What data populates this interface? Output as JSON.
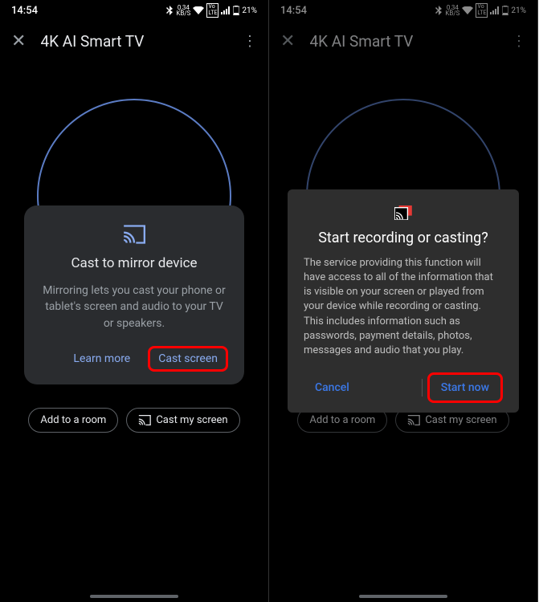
{
  "status": {
    "time": "14:54",
    "speed": "0,34",
    "speed_unit": "KB/S",
    "battery": "21%"
  },
  "header": {
    "title": "4K AI Smart TV"
  },
  "screen1": {
    "card": {
      "title": "Cast to mirror device",
      "body": "Mirroring lets you cast your phone or tablet's screen and audio to your TV or speakers.",
      "learn_more": "Learn more",
      "cast_screen": "Cast screen"
    }
  },
  "chips": {
    "add_room": "Add to a room",
    "cast_my_screen": "Cast my screen"
  },
  "screen2": {
    "dialog": {
      "title": "Start recording or casting?",
      "body": "The service providing this function will have access to all of the information that is visible on your screen or played from your device while recording or casting. This includes information such as passwords, payment details, photos, messages and audio that you play.",
      "cancel": "Cancel",
      "start": "Start now"
    }
  }
}
